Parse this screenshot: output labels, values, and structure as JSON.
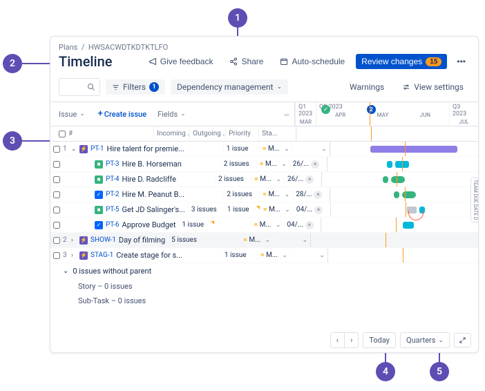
{
  "breadcrumb": {
    "root": "Plans",
    "code": "HWSACWDTKDTKTLFO"
  },
  "title": "Timeline",
  "actions": {
    "feedback": "Give feedback",
    "share": "Share",
    "autoschedule": "Auto-schedule",
    "review": "Review changes",
    "review_count": "15"
  },
  "toolbar": {
    "filters": "Filters",
    "filters_count": "1",
    "dependency": "Dependency management",
    "warnings": "Warnings",
    "view_settings": "View settings"
  },
  "grid": {
    "issue_label": "Issue",
    "create_issue": "Create issue",
    "fields_label": "Fields",
    "hash": "#",
    "cols": [
      "Incoming ...",
      "Outgoing ...",
      "Priority",
      "Sta..."
    ],
    "q1": {
      "label": "Q1 2023",
      "months": [
        "MAR"
      ]
    },
    "q2": {
      "label": "Q2 2023",
      "months": [
        "APR",
        "MAY",
        "JUN"
      ]
    },
    "q3": {
      "label": "Q3 2023",
      "months": [
        "JUL"
      ]
    }
  },
  "due_date_label": "TEAM  DUE DATE D",
  "markers": {
    "may_count": "2"
  },
  "rows": [
    {
      "num": "1",
      "expand": "⌄",
      "indent": 0,
      "icon": "epic",
      "key": "PT-1",
      "summary": "Hire talent for premie...",
      "incoming": "",
      "outgoing": "1 issue",
      "priority": "M...",
      "start": "",
      "tri_in": false,
      "tri_out": false
    },
    {
      "num": "",
      "expand": "",
      "indent": 1,
      "icon": "story",
      "key": "PT-3",
      "summary": "Hire B. Horseman",
      "incoming": "",
      "outgoing": "2 issues",
      "priority": "M...",
      "start": "26/...",
      "tri_in": true,
      "tri_out": false
    },
    {
      "num": "",
      "expand": "",
      "indent": 1,
      "icon": "story",
      "key": "PT-4",
      "summary": "Hire D. Radcliffe",
      "incoming": "",
      "outgoing": "2 issues",
      "priority": "M...",
      "start": "26/...",
      "tri_in": true,
      "tri_out": false
    },
    {
      "num": "",
      "expand": "",
      "indent": 1,
      "icon": "task",
      "key": "PT-2",
      "summary": "Hire M. Peanut B...",
      "incoming": "",
      "outgoing": "2 issues",
      "priority": "M...",
      "start": "28/...",
      "tri_in": true,
      "tri_out": false
    },
    {
      "num": "",
      "expand": "",
      "indent": 1,
      "icon": "story",
      "key": "PT-5",
      "summary": "Get JD Salinger's...",
      "incoming": "3 issues",
      "outgoing": "1 issue",
      "priority": "M...",
      "start": "04/...",
      "tri_in": false,
      "tri_out": true
    },
    {
      "num": "",
      "expand": "",
      "indent": 1,
      "icon": "task",
      "key": "PT-6",
      "summary": "Approve Budget",
      "incoming": "1 issue",
      "outgoing": "",
      "priority": "M...",
      "start": "04/...",
      "tri_in": true,
      "tri_out": false
    },
    {
      "num": "2",
      "expand": "›",
      "indent": 0,
      "icon": "epic",
      "key": "SHOW-1",
      "summary": "Day of filming",
      "incoming": "5 issues",
      "outgoing": "",
      "priority": "M...",
      "start": "",
      "tri_in": false,
      "tri_out": true,
      "selected": true
    },
    {
      "num": "3",
      "expand": "›",
      "indent": 0,
      "icon": "epic",
      "key": "STAG-1",
      "summary": "Create stage for s...",
      "incoming": "",
      "outgoing": "1 issue",
      "priority": "M...",
      "start": "",
      "tri_in": false,
      "tri_out": false
    }
  ],
  "noparent": {
    "header": "0 issues without parent",
    "story": "Story – 0 issues",
    "subtask": "Sub-Task – 0 issues"
  },
  "footer": {
    "today": "Today",
    "scale": "Quarters"
  },
  "annotations": [
    "1",
    "2",
    "3",
    "4",
    "5"
  ]
}
